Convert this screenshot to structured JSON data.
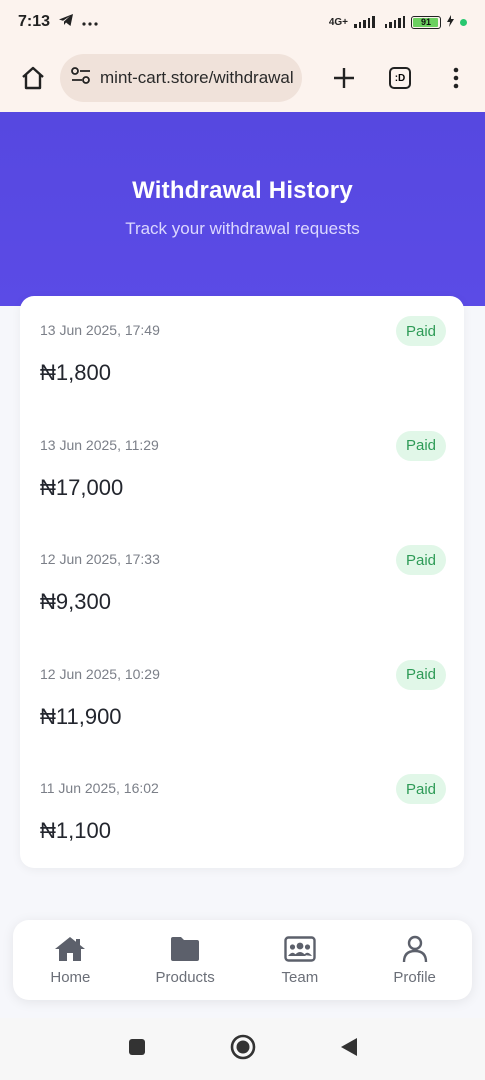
{
  "status_bar": {
    "time": "7:13",
    "network": "4G+",
    "battery": "91"
  },
  "browser": {
    "url": "mint-cart.store/withdrawal",
    "tab_label": ":D"
  },
  "header": {
    "title": "Withdrawal History",
    "subtitle": "Track your withdrawal requests"
  },
  "withdrawals": [
    {
      "date": "13 Jun 2025, 17:49",
      "amount": "₦1,800",
      "status": "Paid"
    },
    {
      "date": "13 Jun 2025, 11:29",
      "amount": "₦17,000",
      "status": "Paid"
    },
    {
      "date": "12 Jun 2025, 17:33",
      "amount": "₦9,300",
      "status": "Paid"
    },
    {
      "date": "12 Jun 2025, 10:29",
      "amount": "₦11,900",
      "status": "Paid"
    },
    {
      "date": "11 Jun 2025, 16:02",
      "amount": "₦1,100",
      "status": "Paid"
    }
  ],
  "bottom_nav": {
    "items": [
      {
        "label": "Home",
        "icon": "home-icon"
      },
      {
        "label": "Products",
        "icon": "folder-icon"
      },
      {
        "label": "Team",
        "icon": "team-icon"
      },
      {
        "label": "Profile",
        "icon": "profile-icon"
      }
    ]
  },
  "colors": {
    "header": "#5648e0",
    "badge_bg": "#e1f7e8",
    "badge_text": "#2e9b57"
  }
}
